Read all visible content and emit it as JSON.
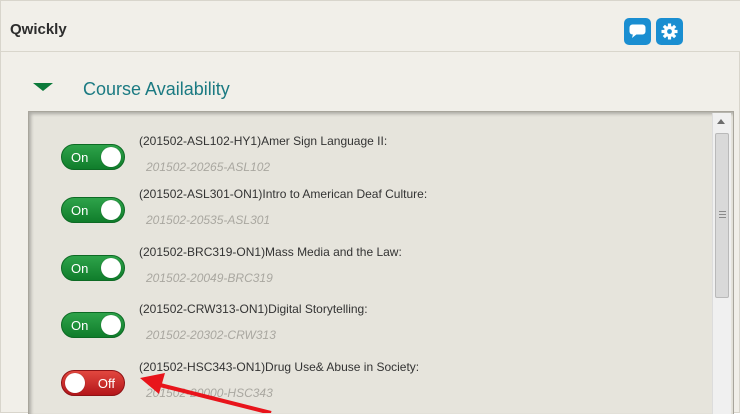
{
  "header": {
    "title": "Qwickly",
    "chat_icon": "chat-bubble-icon",
    "settings_icon": "gear-icon",
    "accent": "#1a8ed1"
  },
  "section": {
    "title": "Course Availability",
    "expanded": true
  },
  "courses": [
    {
      "name": "(201502-ASL102-HY1)Amer Sign Language II:",
      "code": "201502-20265-ASL102",
      "status": "On"
    },
    {
      "name": "(201502-ASL301-ON1)Intro to American Deaf Culture:",
      "code": "201502-20535-ASL301",
      "status": "On"
    },
    {
      "name": "(201502-BRC319-ON1)Mass Media and the Law:",
      "code": "201502-20049-BRC319",
      "status": "On"
    },
    {
      "name": "(201502-CRW313-ON1)Digital Storytelling:",
      "code": "201502-20302-CRW313",
      "status": "On"
    },
    {
      "name": "(201502-HSC343-ON1)Drug Use& Abuse in Society:",
      "code": "201502-20000-HSC343",
      "status": "Off"
    }
  ],
  "colors": {
    "on": "#1f9a3c",
    "off": "#d22b2b",
    "annotation_arrow": "#e8141b"
  }
}
